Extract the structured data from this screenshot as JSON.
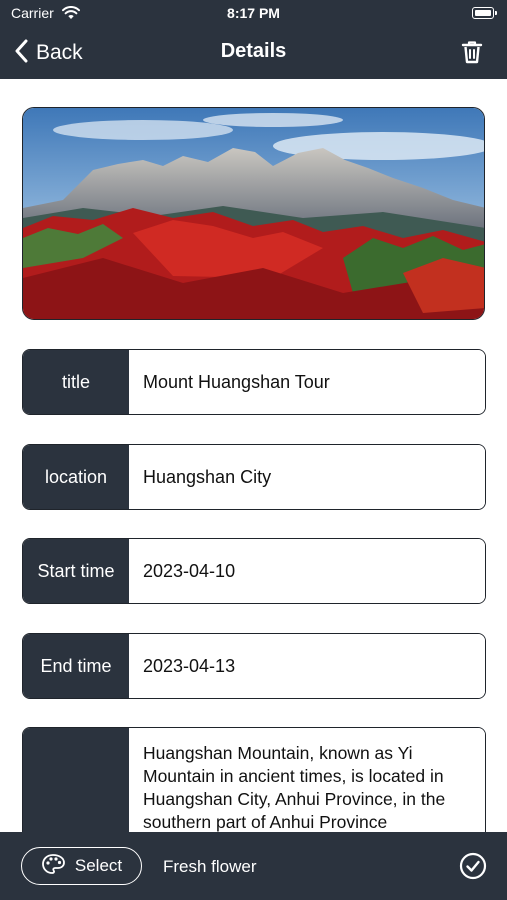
{
  "status_bar": {
    "carrier": "Carrier",
    "time": "8:17 PM"
  },
  "nav": {
    "back_label": "Back",
    "title": "Details"
  },
  "fields": [
    {
      "label": "title",
      "value": "Mount Huangshan Tour"
    },
    {
      "label": "location",
      "value": "Huangshan City"
    },
    {
      "label": "Start time",
      "value": "2023-04-10"
    },
    {
      "label": "End time",
      "value": "2023-04-13"
    }
  ],
  "description": {
    "label": "",
    "value": "Huangshan Mountain, known as Yi Mountain in ancient times, is located in Huangshan City, Anhui Province, in the southern part of Anhui Province"
  },
  "toolbar": {
    "select_label": "Select",
    "selected_value": "Fresh flower"
  },
  "icons": {
    "back": "chevron-left-icon",
    "trash": "trash-icon",
    "palette": "palette-icon",
    "confirm": "checkmark-circle-icon"
  },
  "colors": {
    "bar": "#2b333e",
    "label_bg": "#2b333e",
    "text_on_dark": "#ffffff"
  }
}
